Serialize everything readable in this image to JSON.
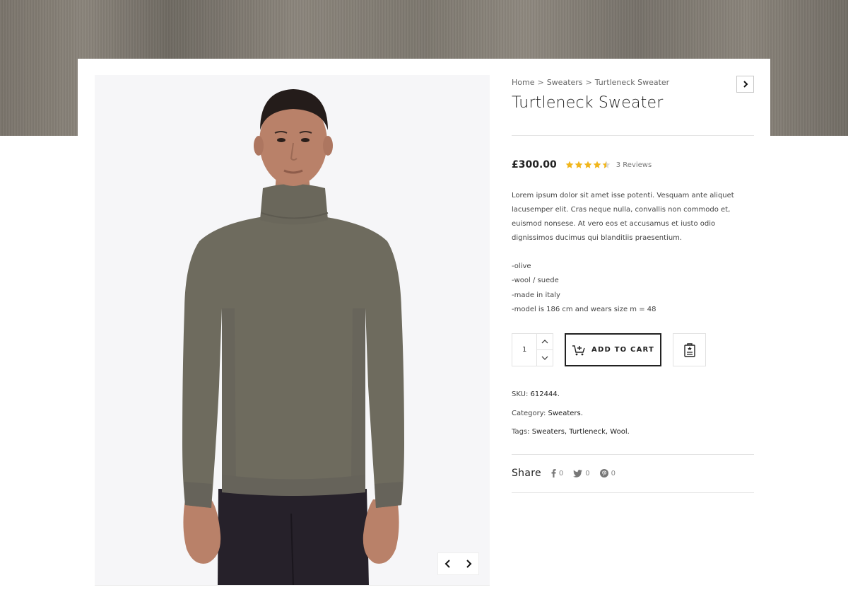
{
  "breadcrumb": {
    "home": "Home",
    "category": "Sweaters",
    "current": "Turtleneck Sweater",
    "separator": ">"
  },
  "product": {
    "title": "Turtleneck Sweater",
    "price": "£300.00",
    "rating": 4.5,
    "rating_max": 5,
    "reviews_label": "3 Reviews",
    "description": "Lorem ipsum dolor sit amet isse potenti. Vesquam ante aliquet lacusemper elit. Cras neque nulla, convallis non commodo et, euismod nonsese. At vero eos et accusamus et iusto odio dignissimos ducimus qui blanditiis praesentium.",
    "features": [
      "-olive",
      "-wool / suede",
      "-made in italy",
      "-model is 186 cm and wears size m = 48"
    ]
  },
  "cart": {
    "quantity": "1",
    "add_to_cart_label": "ADD TO CART"
  },
  "meta": {
    "sku_label": "SKU:",
    "sku_value": "612444.",
    "category_label": "Category:",
    "category_value": "Sweaters.",
    "tags_label": "Tags:",
    "tags_value": "Sweaters, Turtleneck, Wool."
  },
  "share": {
    "label": "Share",
    "facebook_count": "0",
    "twitter_count": "0",
    "pinterest_count": "0"
  },
  "colors": {
    "star": "#f1b61c",
    "hero_band": "#7d786f",
    "sweater": "#6e6b5e",
    "text": "#222222"
  },
  "icons": {
    "next_product": "chevron-right-icon",
    "gallery_prev": "chevron-left-icon",
    "gallery_next": "chevron-right-icon",
    "qty_up": "chevron-up-icon",
    "qty_down": "chevron-down-icon",
    "cart": "cart-plus-icon",
    "wishlist": "clipboard-star-icon",
    "facebook": "facebook-icon",
    "twitter": "twitter-icon",
    "pinterest": "pinterest-icon"
  }
}
